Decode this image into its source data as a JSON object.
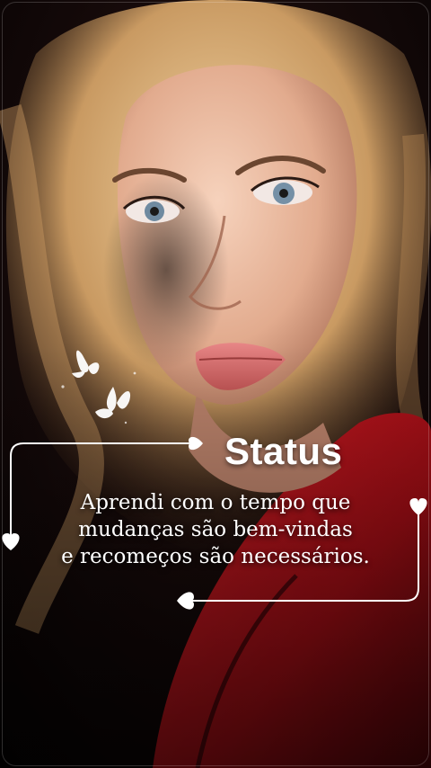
{
  "status": {
    "title": "Status",
    "quote_lines": [
      "Aprendi com o tempo que",
      "mudanças são bem-vindas",
      "e recomeços são necessários."
    ]
  },
  "icons": [
    "butterfly-icon",
    "heart-icon"
  ],
  "colors": {
    "background": "#0b0505",
    "hair": "#d8b27e",
    "skin": "#e8b89a",
    "lips": "#d86a6a",
    "jacket": "#b3121a",
    "text": "#ffffff"
  }
}
